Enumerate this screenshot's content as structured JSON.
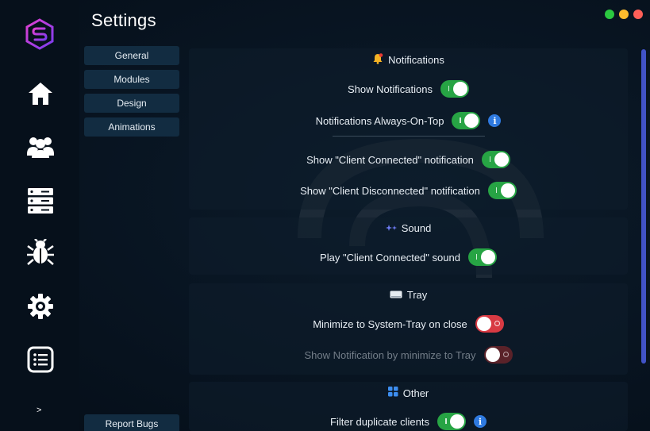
{
  "app": {
    "title": "Settings",
    "expand_label": ">",
    "report_bugs_label": "Report Bugs",
    "logo_icon": "hexagon-s-logo-icon",
    "colors": {
      "accent": "#2f7ae0",
      "toggle_on": "#27a444",
      "toggle_off": "#d83a43",
      "scrollbar": "#4153c7",
      "button_bg": "#122c41"
    }
  },
  "window_controls": [
    {
      "name": "maximize",
      "color": "#2bc840"
    },
    {
      "name": "minimize",
      "color": "#fdbb2d"
    },
    {
      "name": "close",
      "color": "#fe5f58"
    }
  ],
  "sidebar": {
    "items": [
      {
        "name": "home",
        "icon": "home-icon"
      },
      {
        "name": "clients",
        "icon": "users-icon"
      },
      {
        "name": "servers",
        "icon": "server-icon"
      },
      {
        "name": "bug",
        "icon": "bug-icon"
      },
      {
        "name": "settings",
        "icon": "gear-icon"
      },
      {
        "name": "logs",
        "icon": "list-icon"
      }
    ]
  },
  "subnav": {
    "items": [
      {
        "label": "General"
      },
      {
        "label": "Modules"
      },
      {
        "label": "Design"
      },
      {
        "label": "Animations"
      }
    ]
  },
  "sections": {
    "notifications": {
      "title": "Notifications",
      "icon": "bell-icon",
      "settings": [
        {
          "label": "Show Notifications",
          "value": true,
          "info": false
        },
        {
          "label": "Notifications Always-On-Top",
          "value": true,
          "info": true
        },
        {
          "label": "Show \"Client Connected\" notification",
          "value": true,
          "info": false
        },
        {
          "label": "Show \"Client Disconnected\" notification",
          "value": true,
          "info": false
        }
      ]
    },
    "sound": {
      "title": "Sound",
      "icon": "sound-sparkle-icon",
      "settings": [
        {
          "label": "Play \"Client Connected\" sound",
          "value": true,
          "info": false
        }
      ]
    },
    "tray": {
      "title": "Tray",
      "icon": "tray-icon",
      "settings": [
        {
          "label": "Minimize to System-Tray on close",
          "value": false,
          "enabled": true
        },
        {
          "label": "Show Notification by minimize to Tray",
          "value": false,
          "enabled": false
        }
      ]
    },
    "other": {
      "title": "Other",
      "icon": "grid-icon",
      "settings": [
        {
          "label": "Filter duplicate clients",
          "value": true,
          "info": true
        }
      ]
    }
  },
  "info_glyph": "i"
}
